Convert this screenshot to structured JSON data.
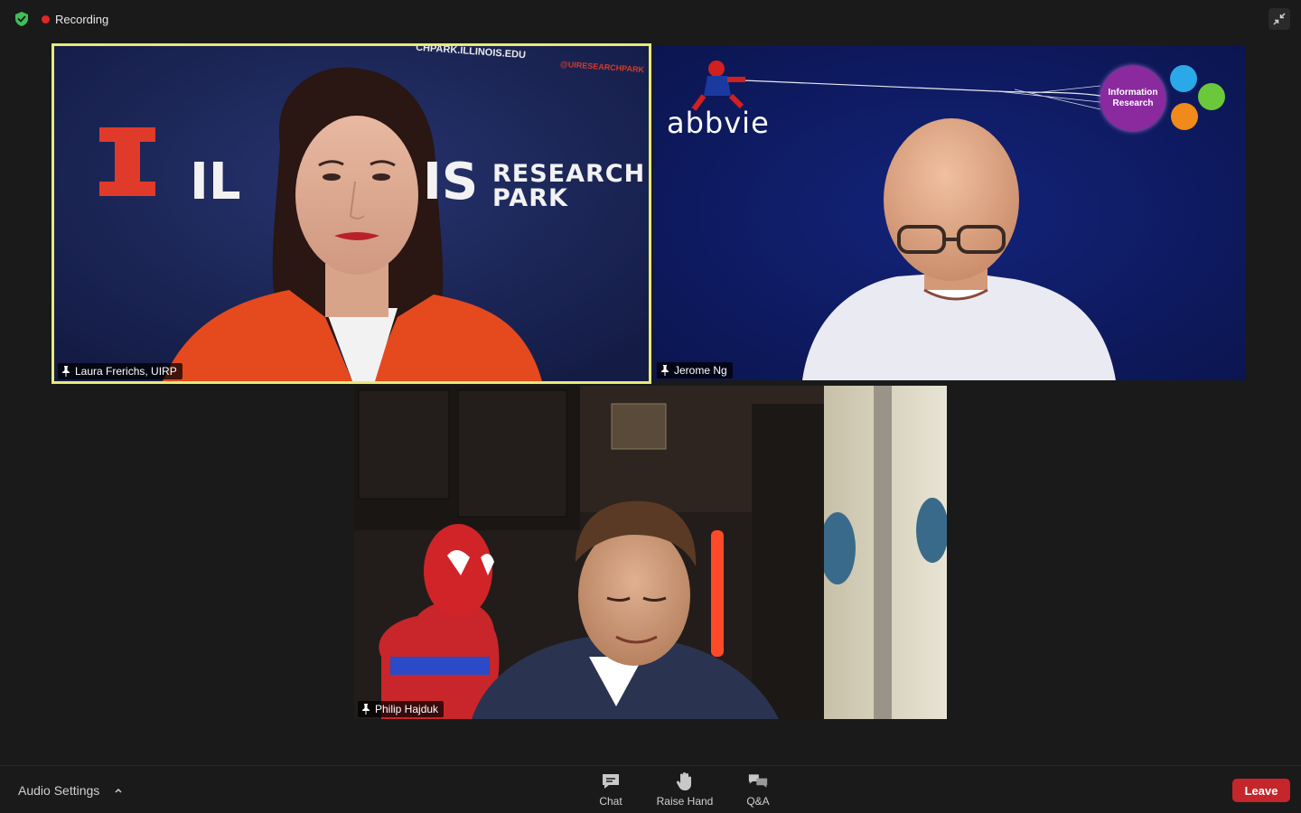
{
  "status": {
    "recording_label": "Recording"
  },
  "participants": [
    {
      "name": "Laura Frerichs, UIRP",
      "active_speaker": true
    },
    {
      "name": "Jerome Ng",
      "active_speaker": false
    },
    {
      "name": "Philip Hajduk",
      "active_speaker": false
    }
  ],
  "backgrounds": {
    "tile1": {
      "url": "CHPARK.ILLINOIS.EDU",
      "handle": "@UIRESEARCHPARK",
      "word_il": "IL",
      "word_is": "IS",
      "research": "RESEARCH",
      "park": "PARK"
    },
    "tile2": {
      "logo": "abbvie",
      "circle_line1": "Information",
      "circle_line2": "Research"
    }
  },
  "toolbar": {
    "audio_settings_label": "Audio Settings",
    "chat_label": "Chat",
    "raise_hand_label": "Raise Hand",
    "qa_label": "Q&A",
    "leave_label": "Leave"
  },
  "colors": {
    "active_speaker_border": "#e8ea78",
    "leave_button": "#c4262b",
    "recording_dot": "#e02828",
    "shield": "#3fbf5a"
  },
  "icons": {
    "security": "shield-check-icon",
    "fullscreen": "exit-fullscreen-icon",
    "pin": "pin-icon",
    "chat": "chat-bubble-icon",
    "raise_hand": "hand-icon",
    "qa": "qa-bubbles-icon"
  }
}
